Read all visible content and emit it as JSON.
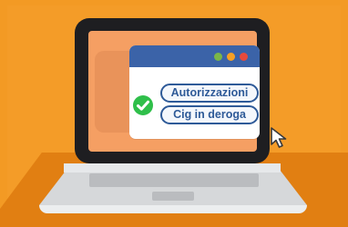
{
  "dialog": {
    "buttons": [
      {
        "label": "Autorizzazioni"
      },
      {
        "label": "Cig in deroga"
      }
    ]
  },
  "icons": {
    "check": "check-circle-icon",
    "cursor": "mouse-pointer-icon"
  },
  "colors": {
    "background": "#f39a24",
    "screen": "#f59f63",
    "titlebar": "#3b63a8",
    "pill_border": "#2e5a98",
    "check": "#2fbf4a"
  }
}
